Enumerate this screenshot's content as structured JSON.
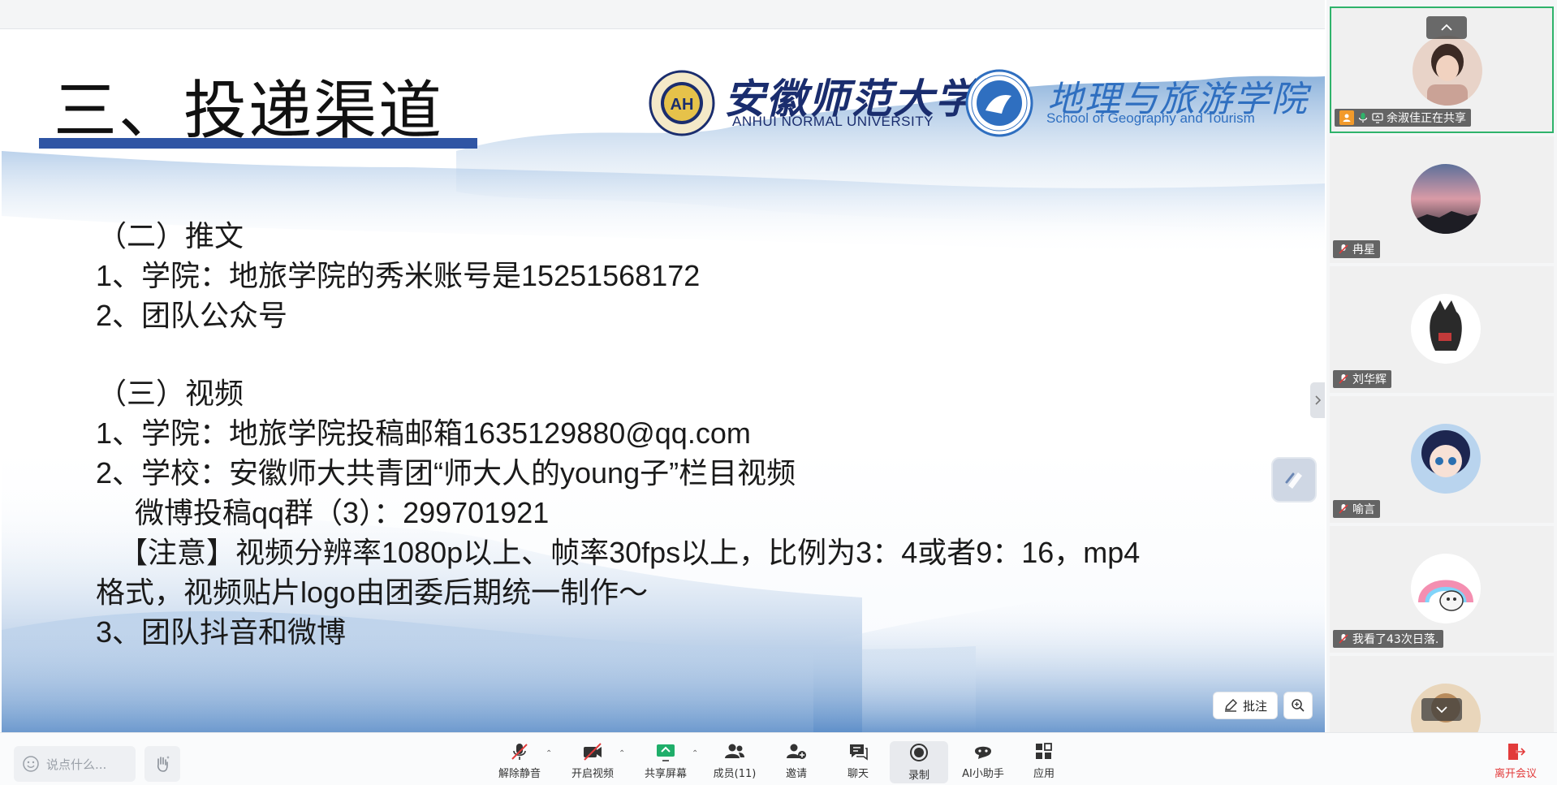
{
  "slide": {
    "title": "三、投递渠道",
    "logo_university_cn": "安徽师范大学",
    "logo_university_en": "ANHUI NORMAL UNIVERSITY",
    "logo_school_cn": "地理与旅游学院",
    "logo_school_en": "School of Geography and Tourism",
    "lines": [
      "（二）推文",
      "1、学院：地旅学院的秀米账号是15251568172",
      "2、团队公众号",
      "（三）视频",
      "1、学院：地旅学院投稿邮箱1635129880@qq.com",
      "2、学校：安徽师大共青团“师大人的young子”栏目视频",
      "微博投稿qq群（3）：299701921",
      "【注意】视频分辨率1080p以上、帧率30fps以上，比例为3：4或者9：16，mp4",
      "格式，视频贴片logo由团委后期统一制作～",
      "3、团队抖音和微博"
    ]
  },
  "slide_controls": {
    "annotate_label": "批注"
  },
  "participants": [
    {
      "name": "余淑佳正在共享",
      "role": "host",
      "sharing": true,
      "avatar_color": "#d9b7a8"
    },
    {
      "name": "冉星",
      "muted": true,
      "avatar_color": "#b58aa8"
    },
    {
      "name": "刘华辉",
      "muted": true,
      "avatar_color": "#ffffff"
    },
    {
      "name": "喻言",
      "muted": true,
      "avatar_color": "#2c3b6e"
    },
    {
      "name": "我看了43次日落.",
      "muted": true,
      "avatar_color": "#f7c9d6"
    }
  ],
  "toolbar": {
    "chat_placeholder": "说点什么...",
    "buttons": [
      {
        "id": "unmute",
        "label": "解除静音"
      },
      {
        "id": "video",
        "label": "开启视频"
      },
      {
        "id": "share",
        "label": "共享屏幕"
      },
      {
        "id": "members",
        "label": "成员(11)"
      },
      {
        "id": "invite",
        "label": "邀请"
      },
      {
        "id": "chat",
        "label": "聊天"
      },
      {
        "id": "record",
        "label": "录制"
      },
      {
        "id": "ai",
        "label": "AI小助手"
      },
      {
        "id": "apps",
        "label": "应用"
      }
    ],
    "leave_label": "离开会议",
    "colors": {
      "leave": "#e23b3b",
      "share": "#1fae6a",
      "muted": "#e23b3b"
    }
  }
}
